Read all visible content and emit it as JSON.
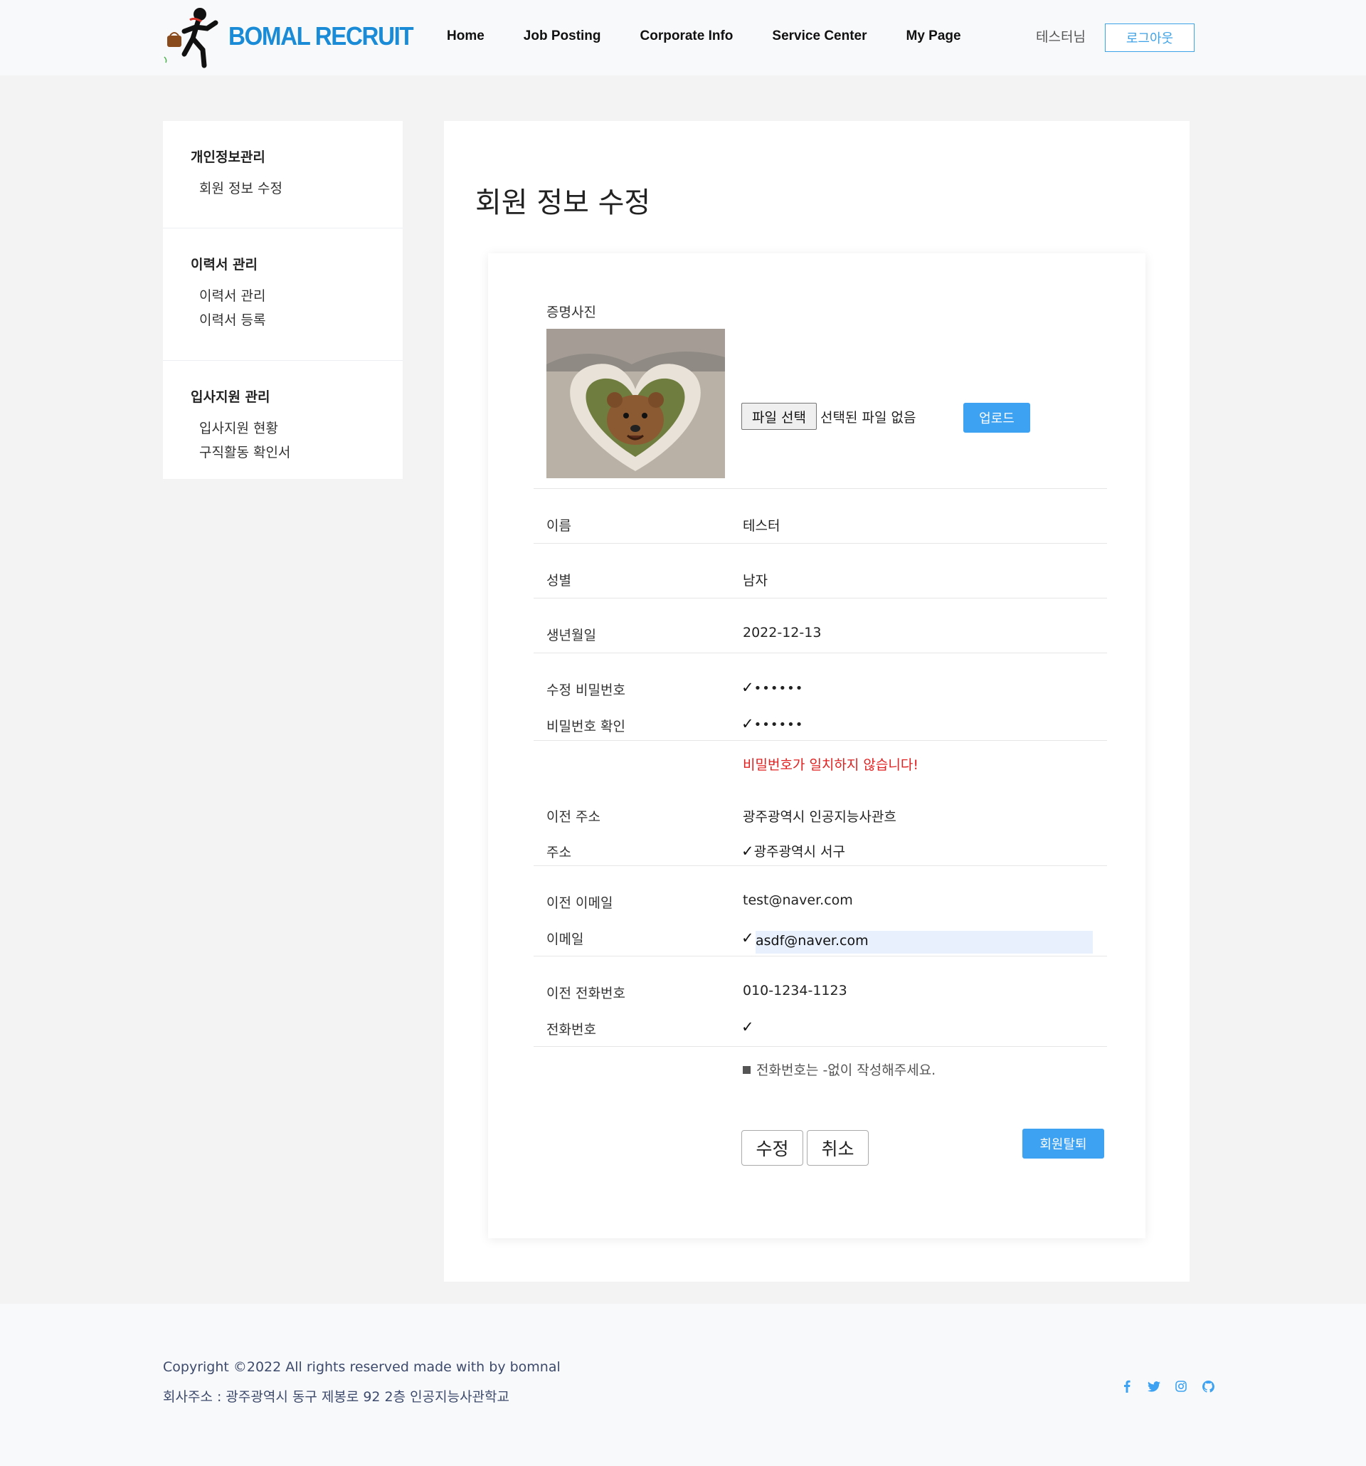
{
  "header": {
    "brand": "BOMAL RECRUIT",
    "nav": [
      "Home",
      "Job Posting",
      "Corporate Info",
      "Service Center",
      "My Page"
    ],
    "greeting": "테스터님",
    "logout_label": "로그아웃"
  },
  "sidebar": {
    "sections": [
      {
        "title": "개인정보관리",
        "links": [
          "회원 정보 수정"
        ]
      },
      {
        "title": "이력서 관리",
        "links": [
          "이력서 관리",
          "이력서 등록"
        ]
      },
      {
        "title": "입사지원 관리",
        "links": [
          "입사지원 현황",
          "구직활동 확인서"
        ]
      }
    ]
  },
  "main": {
    "title": "회원 정보 수정",
    "photo_label": "증명사진",
    "file_button": "파일 선택",
    "file_status": "선택된 파일 없음",
    "upload_label": "업로드",
    "fields": {
      "name_label": "이름",
      "name_value": "테스터",
      "gender_label": "성별",
      "gender_value": "남자",
      "birth_label": "생년월일",
      "birth_value": "2022-12-13",
      "new_pw_label": "수정 비밀번호",
      "new_pw_value": "••••••",
      "confirm_pw_label": "비밀번호 확인",
      "confirm_pw_value": "••••••",
      "pw_error": "비밀번호가 일치하지 않습니다!",
      "prev_addr_label": "이전 주소",
      "prev_addr_value": "광주광역시 인공지능사관흐",
      "addr_label": "주소",
      "addr_value": "광주광역시 서구",
      "prev_email_label": "이전 이메일",
      "prev_email_value": "test@naver.com",
      "email_label": "이메일",
      "email_value": "asdf@naver.com",
      "prev_phone_label": "이전 전화번호",
      "prev_phone_value": "010-1234-1123",
      "phone_label": "전화번호",
      "phone_value": "",
      "phone_hint": "전화번호는 -없이 작성해주세요."
    },
    "check_mark": "✓",
    "submit_label": "수정",
    "cancel_label": "취소",
    "withdraw_label": "회원탈퇴"
  },
  "footer": {
    "copyright": "Copyright ©2022 All rights reserved made with by bomnal",
    "address": "회사주소 : 광주광역시 동구 제봉로 92 2층 인공지능사관학교",
    "social_icons": [
      "facebook-icon",
      "twitter-icon",
      "instagram-icon",
      "github-icon"
    ]
  },
  "colors": {
    "accent": "#3da2f2",
    "brand": "#1a8bd6",
    "error": "#e02020"
  }
}
